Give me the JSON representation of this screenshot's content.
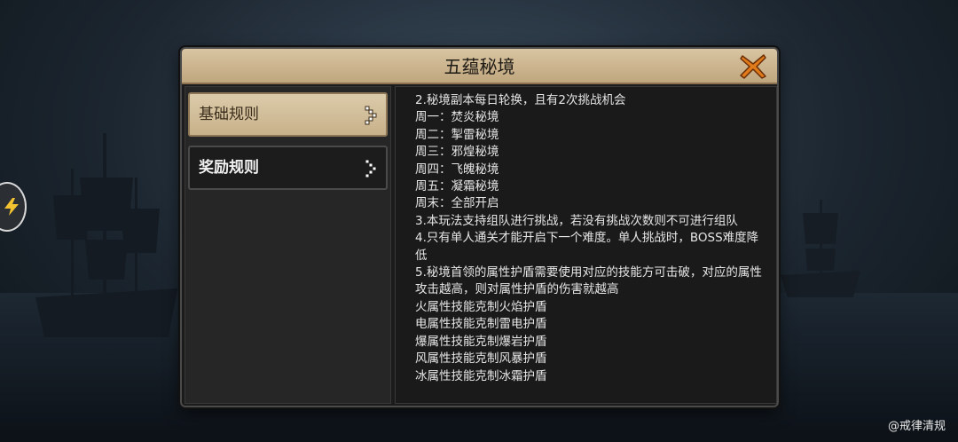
{
  "dialog": {
    "title": "五蕴秘境"
  },
  "tabs": [
    {
      "label": "基础规则",
      "active": true
    },
    {
      "label": "奖励规则",
      "active": false
    }
  ],
  "rules": [
    "2.秘境副本每日轮换，且有2次挑战机会",
    "周一：焚炎秘境",
    "周二：掣雷秘境",
    "周三：邪煌秘境",
    "周四：飞魄秘境",
    "周五：凝霜秘境",
    "周末：全部开启",
    "3.本玩法支持组队进行挑战，若没有挑战次数则不可进行组队",
    "4.只有单人通关才能开启下一个难度。单人挑战时，BOSS难度降低",
    "5.秘境首领的属性护盾需要使用对应的技能方可击破，对应的属性攻击越高，则对属性护盾的伤害就越高",
    "火属性技能克制火焰护盾",
    "电属性技能克制雷电护盾",
    "爆属性技能克制爆岩护盾",
    "风属性技能克制风暴护盾",
    "冰属性技能克制冰霜护盾"
  ],
  "icons": {
    "close": "close-x-icon",
    "tab_arrow": "chevron-right-icon",
    "side_badge": "side-floating-badge-icon"
  },
  "colors": {
    "title_bar": "#d9c5a2",
    "close_x": "#e07a1a",
    "panel_bg": "#1a1a1a",
    "text": "#e6e6e6"
  },
  "watermark": "@戒律清规"
}
